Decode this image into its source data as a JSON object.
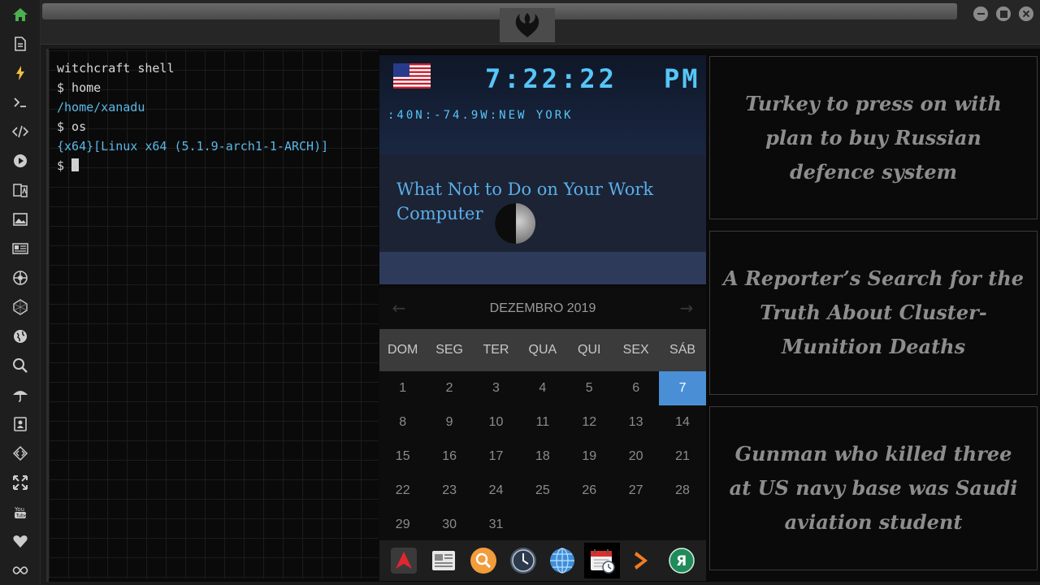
{
  "window": {
    "minimize_label": "minimize",
    "maximize_label": "maximize",
    "close_label": "close"
  },
  "sidebar": {
    "items": [
      {
        "icon": "home-icon",
        "color": "#4caf50"
      },
      {
        "icon": "document-icon"
      },
      {
        "icon": "bolt-icon",
        "color": "#f0c040"
      },
      {
        "icon": "terminal-icon"
      },
      {
        "icon": "code-icon"
      },
      {
        "icon": "play-icon"
      },
      {
        "icon": "translate-icon"
      },
      {
        "icon": "image-icon"
      },
      {
        "icon": "newspaper-icon"
      },
      {
        "icon": "empire-icon"
      },
      {
        "icon": "hexagon-icon"
      },
      {
        "icon": "globe-icon"
      },
      {
        "icon": "search-icon"
      },
      {
        "icon": "umbrella-icon"
      },
      {
        "icon": "contacts-icon"
      },
      {
        "icon": "diamond-code-icon"
      },
      {
        "icon": "expand-icon"
      },
      {
        "icon": "youtube-icon"
      },
      {
        "icon": "heart-icon"
      },
      {
        "icon": "infinity-icon"
      }
    ]
  },
  "terminal": {
    "title": "witchcraft shell",
    "lines": [
      {
        "text": "$ home",
        "color": "white"
      },
      {
        "text": "/home/xanadu",
        "color": "blue"
      },
      {
        "text": "$ os",
        "color": "white"
      },
      {
        "text": "{x64}[Linux x64 (5.1.9-arch1-1-ARCH)]",
        "color": "blue"
      }
    ],
    "prompt": "$ "
  },
  "clock": {
    "time": "7:22:22",
    "ampm": "PM",
    "location": ":40N:-74.9W:NEW YORK",
    "flag": "us-flag-icon",
    "accent": "#56c6f7"
  },
  "article": {
    "title": "What Not to Do on Your Work Computer",
    "moon": "moon-phase-icon"
  },
  "calendar": {
    "month_label": "DEZEMBRO 2019",
    "prev": "←",
    "next": "→",
    "weekdays": [
      "DOM",
      "SEG",
      "TER",
      "QUA",
      "QUI",
      "SEX",
      "SÁB"
    ],
    "weeks": [
      [
        "1",
        "2",
        "3",
        "4",
        "5",
        "6",
        "7"
      ],
      [
        "8",
        "9",
        "10",
        "11",
        "12",
        "13",
        "14"
      ],
      [
        "15",
        "16",
        "17",
        "18",
        "19",
        "20",
        "21"
      ],
      [
        "22",
        "23",
        "24",
        "25",
        "26",
        "27",
        "28"
      ],
      [
        "29",
        "30",
        "31",
        "",
        "",
        "",
        ""
      ]
    ],
    "selected": "7",
    "selected_color": "#4a8fd6"
  },
  "dock": {
    "items": [
      {
        "icon": "launcher-icon"
      },
      {
        "icon": "news-reader-icon"
      },
      {
        "icon": "search-app-icon"
      },
      {
        "icon": "clock-app-icon"
      },
      {
        "icon": "browser-globe-icon"
      },
      {
        "icon": "calendar-app-icon",
        "active": true
      },
      {
        "icon": "chevron-right-app-icon"
      },
      {
        "icon": "translator-icon",
        "text": "Я"
      }
    ]
  },
  "news": [
    {
      "headline": "Turkey to press on with plan to buy Russian defence system"
    },
    {
      "headline": "A Reporter’s Search for the Truth About Cluster-Munition Deaths"
    },
    {
      "headline": "Gunman who killed three at US navy base was Saudi aviation student"
    }
  ]
}
